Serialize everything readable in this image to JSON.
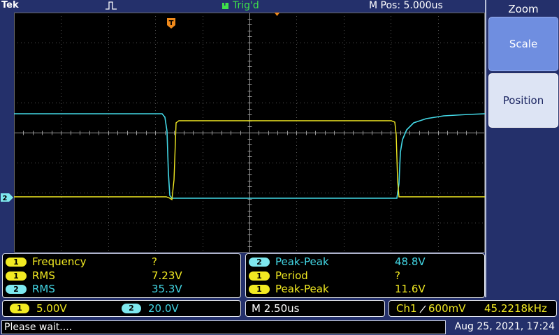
{
  "header": {
    "brand": "Tek",
    "trigger_status": "Trig'd",
    "horizontal_position": "M Pos: 5.000us"
  },
  "colors": {
    "ch1": "#f2ea22",
    "ch2": "#43d8e6",
    "trigger": "#f08a1c",
    "background": "#24306b"
  },
  "markers": {
    "trigger_pos_label": "T",
    "ch2_level_label": "2"
  },
  "side_menu": {
    "title": "Zoom",
    "buttons": [
      {
        "label": "Scale",
        "selected": true
      },
      {
        "label": "Position",
        "selected": false
      }
    ]
  },
  "measurements_left": [
    {
      "channel": "1",
      "name": "Frequency",
      "value": "?"
    },
    {
      "channel": "1",
      "name": "RMS",
      "value": "7.23V"
    },
    {
      "channel": "2",
      "name": "RMS",
      "value": "35.3V"
    }
  ],
  "measurements_right": [
    {
      "channel": "2",
      "name": "Peak-Peak",
      "value": "48.8V"
    },
    {
      "channel": "1",
      "name": "Period",
      "value": "?"
    },
    {
      "channel": "1",
      "name": "Peak-Peak",
      "value": "11.6V"
    }
  ],
  "channel_scales": [
    {
      "channel": "1",
      "scale": "5.00V"
    },
    {
      "channel": "2",
      "scale": "20.0V"
    }
  ],
  "timebase": "M 2.50us",
  "trigger": {
    "source": "Ch1",
    "slope_icon": "rising-edge-icon",
    "level": "600mV",
    "frequency": "45.2218kHz"
  },
  "status": {
    "message": "Please wait....",
    "datetime": "Aug 25, 2021, 17:24"
  }
}
